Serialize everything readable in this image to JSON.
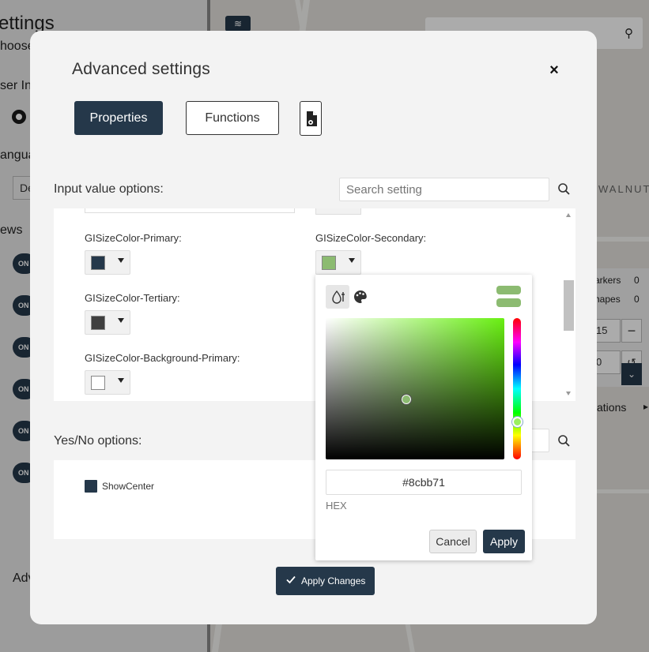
{
  "background": {
    "title": "ettings",
    "choose": "hoose",
    "user_int": "ser Int",
    "language": "angua",
    "language_select": "De",
    "news": "ews",
    "toggle_label": "ON",
    "advanced": "Adv",
    "map_label": "WALNUT",
    "panel": {
      "markers_label": "arkers",
      "markers_count": "0",
      "shapes_label": "hapes",
      "shapes_count": "0",
      "zoom_value": "15",
      "offset_value": "0",
      "minus": "−",
      "undo": "↺",
      "chevron": "⌄"
    },
    "ations_label": "ations"
  },
  "modal": {
    "title": "Advanced settings",
    "close": "×",
    "tabs": {
      "properties": "Properties",
      "functions": "Functions"
    },
    "input_section": {
      "label": "Input value options:",
      "search_placeholder": "Search setting",
      "properties": [
        {
          "label": "GISizeColor-Primary:",
          "color": "#25384a"
        },
        {
          "label": "GISizeColor-Secondary:",
          "color": "#8cbb71"
        },
        {
          "label": "GISizeColor-Tertiary:",
          "color": "#3f3f3f"
        },
        {
          "label": "GISizeColor-Background-Primary:",
          "color": "#ffffff"
        }
      ]
    },
    "yesno_section": {
      "label": "Yes/No options:",
      "items": [
        {
          "label": "ShowCenter",
          "checked": true
        }
      ]
    },
    "apply_changes": "Apply Changes"
  },
  "color_picker": {
    "hex_value": "#8cbb71",
    "hex_label": "HEX",
    "cancel": "Cancel",
    "apply": "Apply",
    "hue_color": "#69f012",
    "selected_color": "#8cbb71"
  }
}
